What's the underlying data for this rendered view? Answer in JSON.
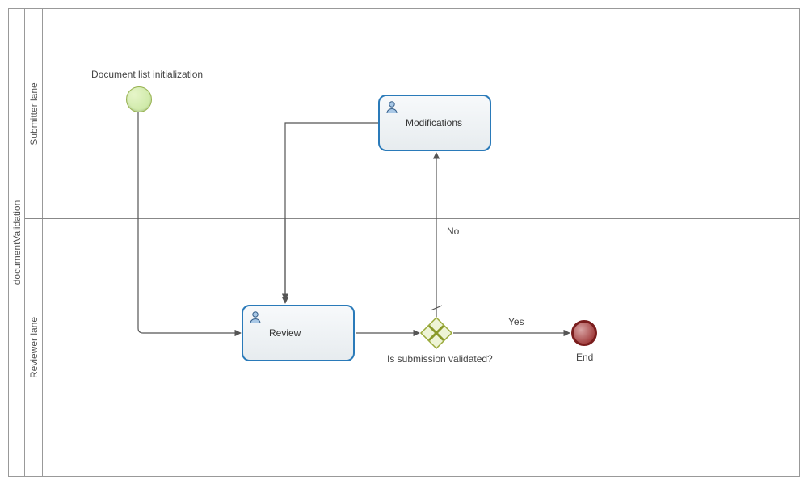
{
  "pool": {
    "name": "documentValidation"
  },
  "lanes": {
    "submitter": {
      "label": "Submitter lane"
    },
    "reviewer": {
      "label": "Reviewer lane"
    }
  },
  "events": {
    "start": {
      "label": "Document list initialization"
    },
    "end": {
      "label": "End"
    }
  },
  "tasks": {
    "modifications": {
      "label": "Modifications"
    },
    "review": {
      "label": "Review"
    }
  },
  "gateways": {
    "validated": {
      "label": "Is submission validated?"
    }
  },
  "flows": {
    "gateway_no": {
      "label": "No"
    },
    "gateway_yes": {
      "label": "Yes"
    }
  }
}
